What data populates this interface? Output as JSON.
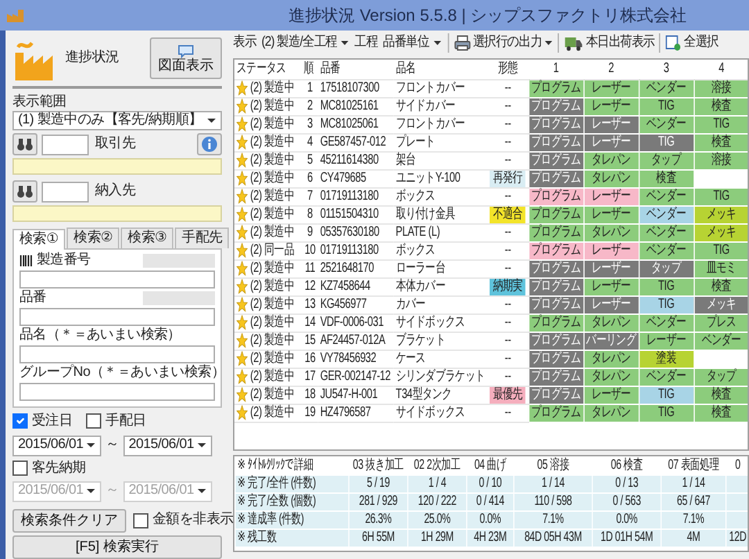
{
  "window": {
    "title": "進捗状況 Version 5.5.8 | シップスファクトリ株式会社"
  },
  "sidebar": {
    "heading": "進捗状況",
    "drawing_button": "図面表示",
    "range_label": "表示範囲",
    "range_select": "(1) 製造中のみ【客先/納期順】",
    "lookups": [
      {
        "label": "取引先",
        "info": true
      },
      {
        "label": "納入先",
        "info": false
      }
    ],
    "search_tabs": [
      {
        "label": "検索①",
        "selected": true
      },
      {
        "label": "検索②",
        "selected": false
      },
      {
        "label": "検索③",
        "selected": false
      },
      {
        "label": "手配先",
        "selected": false
      }
    ],
    "fields": [
      {
        "label": "製造番号",
        "kind": "barcode"
      },
      {
        "label": "品番",
        "kind": "code"
      },
      {
        "label": "品名（＊＝あいまい検索）",
        "kind": "text"
      },
      {
        "label": "グループNo（＊＝あいまい検索）",
        "kind": "text"
      }
    ],
    "date_checks": [
      {
        "label": "受注日",
        "checked": true
      },
      {
        "label": "手配日",
        "checked": false
      }
    ],
    "order_dates": {
      "from": "2015/06/01",
      "separator": "～",
      "to": "2015/06/01",
      "disabled": false
    },
    "delivery_check": {
      "label": "客先納期",
      "checked": false
    },
    "delivery_dates": {
      "from": "2015/06/01",
      "separator": "～",
      "to": "2015/06/01",
      "disabled": true
    },
    "clear_button": "検索条件クリア",
    "hide_amount": {
      "label": "金額を非表示",
      "checked": false
    },
    "search_button": "[F5] 検索実行"
  },
  "toolbar": {
    "display_label": "表示",
    "display_select": "(2) 製造/全工程",
    "process_label": "工程",
    "process_select": "品番単位",
    "buttons": [
      {
        "label": "選択行の出力",
        "kind": "print",
        "dropdown": true
      },
      {
        "label": "本日出荷表示",
        "kind": "truck",
        "dropdown": false
      },
      {
        "label": "全選択",
        "kind": "select-all",
        "dropdown": false
      }
    ]
  },
  "table": {
    "columns": [
      "ステータス",
      "順",
      "品番",
      "品名",
      "形態",
      "1",
      "2",
      "3",
      "4"
    ],
    "rows": [
      {
        "status": "(2) 製造中",
        "no": "1",
        "part_no": "17518107300",
        "name": "フロントカバー",
        "form": {
          "text": "--"
        },
        "steps": [
          {
            "label": "プログラム",
            "color": "#8ccc7c"
          },
          {
            "label": "レーザー",
            "color": "#8ccc7c"
          },
          {
            "label": "ベンダー",
            "color": "#8ccc7c"
          },
          {
            "label": "溶接",
            "color": "#8ccc7c"
          }
        ]
      },
      {
        "status": "(2) 製造中",
        "no": "2",
        "part_no": "MC81025161",
        "name": "サイドカバー",
        "form": {
          "text": "--"
        },
        "steps": [
          {
            "label": "プログラム",
            "color": "#7a7a7a"
          },
          {
            "label": "レーザー",
            "color": "#8ccc7c"
          },
          {
            "label": "TIG",
            "color": "#8ccc7c"
          },
          {
            "label": "検査",
            "color": "#8ccc7c"
          }
        ]
      },
      {
        "status": "(2) 製造中",
        "no": "3",
        "part_no": "MC81025061",
        "name": "フロントカバー",
        "form": {
          "text": "--"
        },
        "steps": [
          {
            "label": "プログラム",
            "color": "#7a7a7a"
          },
          {
            "label": "レーザー",
            "color": "#7a7a7a"
          },
          {
            "label": "ベンダー",
            "color": "#8ccc7c"
          },
          {
            "label": "TIG",
            "color": "#8ccc7c"
          }
        ]
      },
      {
        "status": "(2) 製造中",
        "no": "4",
        "part_no": "GE587457-012",
        "name": "プレート",
        "form": {
          "text": "--"
        },
        "steps": [
          {
            "label": "プログラム",
            "color": "#7a7a7a"
          },
          {
            "label": "レーザー",
            "color": "#7a7a7a"
          },
          {
            "label": "TIG",
            "color": "#7a7a7a"
          },
          {
            "label": "検査",
            "color": "#8ccc7c"
          }
        ]
      },
      {
        "status": "(2) 製造中",
        "no": "5",
        "part_no": "45211614380",
        "name": "架台",
        "form": {
          "text": "--"
        },
        "steps": [
          {
            "label": "プログラム",
            "color": "#7a7a7a"
          },
          {
            "label": "タレパン",
            "color": "#8ccc7c"
          },
          {
            "label": "タップ",
            "color": "#8ccc7c"
          },
          {
            "label": "溶接",
            "color": "#8ccc7c"
          }
        ]
      },
      {
        "status": "(2) 製造中",
        "no": "6",
        "part_no": "CY479685",
        "name": "ユニットY-100",
        "form": {
          "text": "再発行",
          "color": "#d9edf3"
        },
        "steps": [
          {
            "label": "プログラム",
            "color": "#7a7a7a"
          },
          {
            "label": "タレパン",
            "color": "#8ccc7c"
          },
          {
            "label": "検査",
            "color": "#8ccc7c"
          }
        ]
      },
      {
        "status": "(2) 製造中",
        "no": "7",
        "part_no": "01719113180",
        "name": "ボックス",
        "form": {
          "text": "--"
        },
        "steps": [
          {
            "label": "プログラム",
            "color": "#f7b8c8"
          },
          {
            "label": "レーザー",
            "color": "#f7b8c8"
          },
          {
            "label": "ベンダー",
            "color": "#8ccc7c"
          },
          {
            "label": "TIG",
            "color": "#8ccc7c"
          }
        ]
      },
      {
        "status": "(2) 製造中",
        "no": "8",
        "part_no": "01151504310",
        "name": "取り付け金具",
        "form": {
          "text": "不適合",
          "color": "#f3e42a"
        },
        "steps": [
          {
            "label": "プログラム",
            "color": "#8ccc7c"
          },
          {
            "label": "レーザー",
            "color": "#8ccc7c"
          },
          {
            "label": "ベンダー",
            "color": "#a8d4e6"
          },
          {
            "label": "メッキ",
            "color": "#b7d333"
          }
        ]
      },
      {
        "status": "(2) 製造中",
        "no": "9",
        "part_no": "05357630180",
        "name": "PLATE (L)",
        "form": {
          "text": "--"
        },
        "steps": [
          {
            "label": "プログラム",
            "color": "#8ccc7c"
          },
          {
            "label": "タレパン",
            "color": "#8ccc7c"
          },
          {
            "label": "ベンダー",
            "color": "#8ccc7c"
          },
          {
            "label": "メッキ",
            "color": "#b7d333"
          }
        ]
      },
      {
        "status": "(2) 同一品",
        "no": "10",
        "part_no": "01719113180",
        "name": "ボックス",
        "form": {
          "text": "--"
        },
        "steps": [
          {
            "label": "プログラム",
            "color": "#f7b8c8"
          },
          {
            "label": "レーザー",
            "color": "#f7b8c8"
          },
          {
            "label": "ベンダー",
            "color": "#8ccc7c"
          },
          {
            "label": "TIG",
            "color": "#8ccc7c"
          }
        ]
      },
      {
        "status": "(2) 製造中",
        "no": "11",
        "part_no": "2521648170",
        "name": "ローラー台",
        "form": {
          "text": "--"
        },
        "steps": [
          {
            "label": "プログラム",
            "color": "#7a7a7a"
          },
          {
            "label": "レーザー",
            "color": "#7a7a7a"
          },
          {
            "label": "タップ",
            "color": "#7a7a7a"
          },
          {
            "label": "皿モミ",
            "color": "#8ccc7c"
          }
        ]
      },
      {
        "status": "(2) 製造中",
        "no": "12",
        "part_no": "KZ7458644",
        "name": "本体カバー",
        "form": {
          "text": "納期実",
          "color": "#5fc3dc"
        },
        "steps": [
          {
            "label": "プログラム",
            "color": "#7a7a7a"
          },
          {
            "label": "レーザー",
            "color": "#8ccc7c"
          },
          {
            "label": "TIG",
            "color": "#8ccc7c"
          },
          {
            "label": "検査",
            "color": "#8ccc7c"
          }
        ]
      },
      {
        "status": "(2) 製造中",
        "no": "13",
        "part_no": "KG456977",
        "name": "カバー",
        "form": {
          "text": "--"
        },
        "steps": [
          {
            "label": "プログラム",
            "color": "#7a7a7a"
          },
          {
            "label": "レーザー",
            "color": "#7a7a7a"
          },
          {
            "label": "TIG",
            "color": "#a8d4e6"
          },
          {
            "label": "メッキ",
            "color": "#7a7a7a"
          }
        ]
      },
      {
        "status": "(2) 製造中",
        "no": "14",
        "part_no": "VDF-0006-031",
        "name": "サイドボックス",
        "form": {
          "text": "--"
        },
        "steps": [
          {
            "label": "プログラム",
            "color": "#8ccc7c"
          },
          {
            "label": "タレパン",
            "color": "#8ccc7c"
          },
          {
            "label": "ベンダー",
            "color": "#8ccc7c"
          },
          {
            "label": "プレス",
            "color": "#8ccc7c"
          }
        ]
      },
      {
        "status": "(2) 製造中",
        "no": "15",
        "part_no": "AF24457-012A",
        "name": "ブラケット",
        "form": {
          "text": "--"
        },
        "steps": [
          {
            "label": "プログラム",
            "color": "#7a7a7a"
          },
          {
            "label": "バーリング",
            "color": "#7a7a7a"
          },
          {
            "label": "レーザー",
            "color": "#8ccc7c"
          },
          {
            "label": "ベンダー",
            "color": "#8ccc7c"
          }
        ]
      },
      {
        "status": "(2) 製造中",
        "no": "16",
        "part_no": "VY78456932",
        "name": "ケース",
        "form": {
          "text": "--"
        },
        "steps": [
          {
            "label": "プログラム",
            "color": "#7a7a7a"
          },
          {
            "label": "タレパン",
            "color": "#8ccc7c"
          },
          {
            "label": "塗装",
            "color": "#b7d333"
          }
        ]
      },
      {
        "status": "(2) 製造中",
        "no": "17",
        "part_no": "GER-002147-12",
        "name": "シリンダブラケット",
        "form": {
          "text": "--"
        },
        "steps": [
          {
            "label": "プログラム",
            "color": "#7a7a7a"
          },
          {
            "label": "タレパン",
            "color": "#8ccc7c"
          },
          {
            "label": "ベンダー",
            "color": "#8ccc7c"
          },
          {
            "label": "タップ",
            "color": "#8ccc7c"
          }
        ]
      },
      {
        "status": "(2) 製造中",
        "no": "18",
        "part_no": "JU547-H-001",
        "name": "T34型タンク",
        "form": {
          "text": "最優先",
          "color": "#f5aebd"
        },
        "steps": [
          {
            "label": "プログラム",
            "color": "#7a7a7a"
          },
          {
            "label": "レーザー",
            "color": "#8ccc7c"
          },
          {
            "label": "TIG",
            "color": "#a8d4e6"
          },
          {
            "label": "検査",
            "color": "#8ccc7c"
          }
        ]
      },
      {
        "status": "(2) 製造中",
        "no": "19",
        "part_no": "HZ4796587",
        "name": "サイドボックス",
        "form": {
          "text": "--"
        },
        "steps": [
          {
            "label": "プログラム",
            "color": "#8ccc7c"
          },
          {
            "label": "タレパン",
            "color": "#8ccc7c"
          },
          {
            "label": "TIG",
            "color": "#8ccc7c"
          },
          {
            "label": "検査",
            "color": "#8ccc7c"
          }
        ]
      }
    ]
  },
  "summary": {
    "columns": [
      "※ ﾀｲﾄﾙｸﾘｯｸで詳細",
      "03 抜き加工",
      "02 2次加工",
      "04 曲げ",
      "05 溶接",
      "06 検査",
      "07 表面処理",
      "0"
    ],
    "rows": [
      {
        "label": "※ 完了/全件 (件数)",
        "values": [
          "5 / 19",
          "1 / 4",
          "0 / 10",
          "1 / 14",
          "0 / 13",
          "1 / 14"
        ]
      },
      {
        "label": "※ 完了/全数 (個数)",
        "values": [
          "281 / 929",
          "120 / 222",
          "0 / 414",
          "110 / 598",
          "0 / 563",
          "65 / 647"
        ]
      },
      {
        "label": "※ 達成率 (件数)",
        "values": [
          "26.3%",
          "25.0%",
          "0.0%",
          "7.1%",
          "0.0%",
          "7.1%"
        ]
      },
      {
        "label": "※ 残工数",
        "values": [
          "6H 55M",
          "1H 29M",
          "4H 23M",
          "84D 05H 43M",
          "1D 01H 54M",
          "4M",
          "12D"
        ]
      }
    ]
  }
}
